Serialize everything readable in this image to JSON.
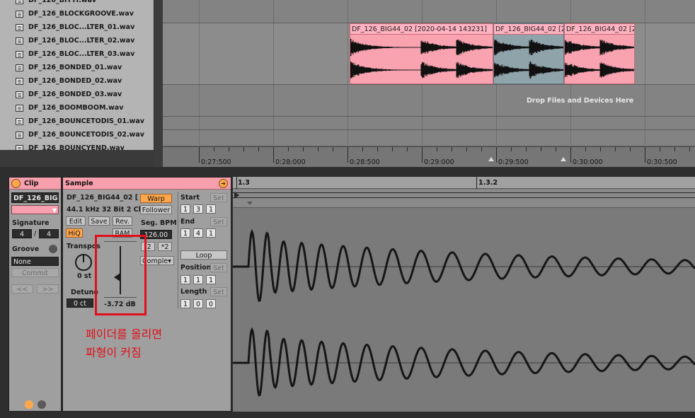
{
  "browser": {
    "files": [
      "DF_126_BITTI.wav",
      "DF_126_BLOCKGROOVE.wav",
      "DF_126_BLOC...LTER_01.wav",
      "DF_126_BLOC...LTER_02.wav",
      "DF_126_BLOC...LTER_03.wav",
      "DF_126_BONDED_01.wav",
      "DF_126_BONDED_02.wav",
      "DF_126_BONDED_03.wav",
      "DF_126_BOOMBOOM.wav",
      "DF_126_BOUNCETODIS_01.wav",
      "DF_126_BOUNCETODIS_02.wav",
      "DF_126_BOUNCYEND.wav"
    ]
  },
  "arrangement": {
    "clips": [
      {
        "title": "DF_126_BIG44_02 [2020-04-14 143231]",
        "color": "pink"
      },
      {
        "title": "DF_126_BIG44_02 [2",
        "color": "blue"
      },
      {
        "title": "DF_126_BIG44_02 [2",
        "color": "pink"
      }
    ],
    "drop_text": "Drop Files and Devices Here",
    "timeline": [
      "0:27:500",
      "0:28:000",
      "0:28:500",
      "0:29:000",
      "0:29:500",
      "0:30:000",
      "0:30:500"
    ]
  },
  "clip_panel": {
    "header": "Clip",
    "name": "DF_126_BIG4",
    "signature_label": "Signature",
    "sig_num": "4",
    "sig_sep": "/",
    "sig_den": "4",
    "groove_label": "Groove",
    "groove_value": "None",
    "commit_label": "Commit",
    "nudge_back": "<<",
    "nudge_fwd": ">>"
  },
  "sample_panel": {
    "header": "Sample",
    "name": "DF_126_BIG44_02 [",
    "info": "44.1 kHz 32 Bit 2 Ch",
    "edit": "Edit",
    "save": "Save",
    "rev": "Rev.",
    "hiq": "HiQ",
    "ram": "RAM",
    "warp": "Warp",
    "warp_mode": "Follower",
    "seg_bpm_label": "Seg. BPM",
    "seg_bpm": "126.00",
    "half": ":2",
    "double": "*2",
    "complex": "Comple",
    "transpose_label": "Transpos",
    "transpose_value": "0 st",
    "detune_label": "Detune",
    "detune_value": "0 ct",
    "gain_value": "-3.72 dB",
    "start_label": "Start",
    "end_label": "End",
    "set": "Set",
    "loop": "Loop",
    "position_label": "Position",
    "length_label": "Length",
    "start_vals": [
      "1",
      "3",
      "1"
    ],
    "end_vals": [
      "1",
      "4",
      "1"
    ],
    "position_vals": [
      "1",
      "1",
      "1"
    ],
    "length_vals": [
      "1",
      "0",
      "0"
    ]
  },
  "editor": {
    "ruler": [
      "1.3",
      "1.3.2"
    ]
  },
  "annotation": {
    "line1": "페이더를 올리면",
    "line2": "파형이 커짐"
  }
}
